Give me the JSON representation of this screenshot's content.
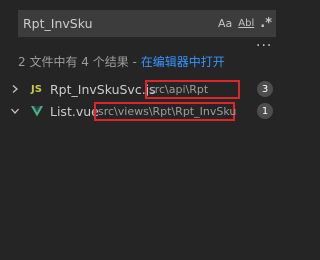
{
  "search": {
    "query": "Rpt_InvSku",
    "match_case": "Aa",
    "whole_word": "Abl",
    "regex": ".*"
  },
  "summary": {
    "text": "2 文件中有 4 个结果 - ",
    "open_in_editor": "在编辑器中打开"
  },
  "results": [
    {
      "file_name": "Rpt_InvSkuSvc.js",
      "path": "src\\api\\Rpt",
      "count": "3",
      "icon_text": "JS",
      "expanded": false
    },
    {
      "file_name": "List.vue",
      "path": "src\\views\\Rpt\\Rpt_InvSku",
      "count": "1",
      "expanded": true
    }
  ],
  "colors": {
    "background": "#252526",
    "input_bg": "#3c3c3c",
    "link": "#3794ff",
    "highlight_border": "#e0242a",
    "js_icon": "#cbcb41",
    "vue_icon": "#41b883"
  }
}
